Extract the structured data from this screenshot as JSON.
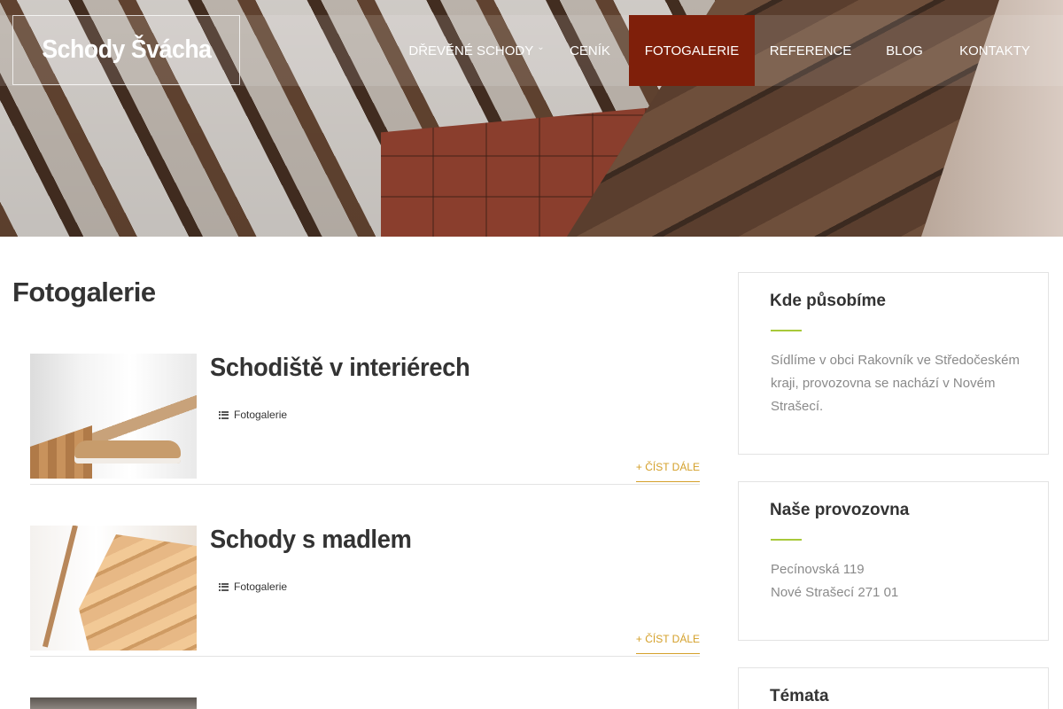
{
  "site": {
    "logo": "Schody Švácha"
  },
  "nav": {
    "items": [
      {
        "label": "DŘEVĚNÉ SCHODY",
        "has_dropdown": true
      },
      {
        "label": "CENÍK"
      },
      {
        "label": "FOTOGALERIE",
        "active": true
      },
      {
        "label": "REFERENCE"
      },
      {
        "label": "BLOG"
      },
      {
        "label": "KONTAKTY"
      }
    ],
    "active_color": "#7f1f0a"
  },
  "main": {
    "title": "Fotogalerie",
    "posts": [
      {
        "title": "Schodiště v interiérech",
        "category": "Fotogalerie",
        "read_more": "+ ČÍST DÁLE"
      },
      {
        "title": "Schody s madlem",
        "category": "Fotogalerie",
        "read_more": "+ ČÍST DÁLE"
      }
    ]
  },
  "sidebar": {
    "widgets": [
      {
        "title": "Kde působíme",
        "text": "Sídlíme v obci Rakovník ve Středočeském kraji, provozovna se nachází v Novém Strašecí."
      },
      {
        "title": "Naše provozovna",
        "lines": [
          "Pecínovská 119",
          "Nové Strašecí 271 01"
        ]
      },
      {
        "title": "Témata"
      }
    ],
    "accent_color": "#a8c93a"
  },
  "colors": {
    "read_more": "#d4a02a"
  }
}
